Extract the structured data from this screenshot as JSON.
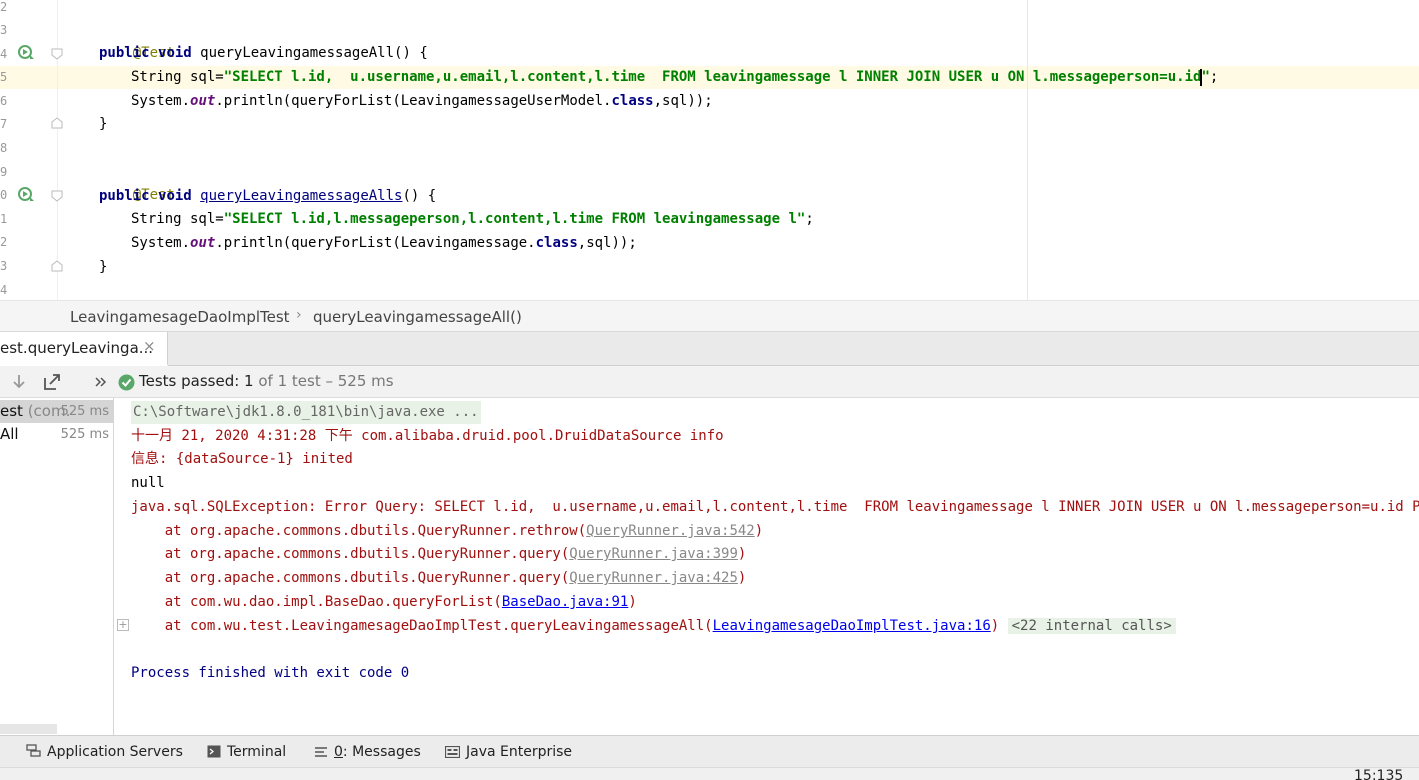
{
  "editor": {
    "line_numbers": [
      "2",
      "3",
      "4",
      "5",
      "6",
      "7",
      "8",
      "9",
      "0",
      "1",
      "2",
      "3",
      "4"
    ],
    "annotation": "@Test",
    "method1_sig": [
      "public",
      "void",
      "queryLeavingamessageAll",
      "() {"
    ],
    "method1_sql_prefix": "String sql=",
    "method1_sql": "\"SELECT l.id,  u.username,u.email,l.content,l.time  FROM leavingamessage l INNER JOIN USER u ON l.messageperson=u.id",
    "method1_sql_end": "\"",
    "line_end": ";",
    "method1_print": [
      "System.",
      "out",
      ".println(queryForList(LeavingamessageUserModel.",
      "class",
      ",sql));"
    ],
    "close_brace": "}",
    "method2_sig": [
      "public",
      "void",
      "queryLeavingamessageAlls",
      "() {"
    ],
    "method2_sql": "\"SELECT l.id,l.messageperson,l.content,l.time FROM leavingamessage l\"",
    "method2_print": [
      "System.",
      "out",
      ".println(queryForList(Leavingamessage.",
      "class",
      ",sql));"
    ]
  },
  "breadcrumb": {
    "class_name": "LeavingamesageDaoImplTest",
    "separator": "›",
    "method_name": "queryLeavingamessageAll()"
  },
  "run_panel": {
    "tab_label": "est.queryLeavinga...",
    "tab_close": "×",
    "tests_passed_label": "Tests passed: ",
    "tests_passed_count": "1",
    "tests_passed_rest": " of 1 test – 525 ms",
    "tree": [
      {
        "name": "est",
        "pkg": " (com.",
        "time": "525 ms"
      },
      {
        "name": "All",
        "pkg": "",
        "time": "525 ms"
      }
    ],
    "console": {
      "cmd": "C:\\Software\\jdk1.8.0_181\\bin\\java.exe ...",
      "log1": "十一月 21, 2020 4:31:28 下午 com.alibaba.druid.pool.DruidDataSource info",
      "log2": "信息: {dataSource-1} inited",
      "null_line": "null",
      "exception": "java.sql.SQLException: Error Query: SELECT l.id,  u.username,u.email,l.content,l.time  FROM leavingamessage l INNER JOIN USER u ON l.messageperson=u.id Parameters: []",
      "stack": [
        {
          "prefix": "    at org.apache.commons.dbutils.QueryRunner.rethrow(",
          "link": "QueryRunner.java:542",
          "suffix": ")"
        },
        {
          "prefix": "    at org.apache.commons.dbutils.QueryRunner.query(",
          "link": "QueryRunner.java:399",
          "suffix": ")"
        },
        {
          "prefix": "    at org.apache.commons.dbutils.QueryRunner.query(",
          "link": "QueryRunner.java:425",
          "suffix": ")"
        },
        {
          "prefix": "    at com.wu.dao.impl.BaseDao.queryForList(",
          "link": "BaseDao.java:91",
          "suffix": ")"
        },
        {
          "prefix": "    at com.wu.test.LeavingamesageDaoImplTest.queryLeavingamessageAll(",
          "link": "LeavingamesageDaoImplTest.java:16",
          "suffix": ")"
        }
      ],
      "internal_calls": "<22 internal calls>",
      "expand_glyph": "+",
      "finished": "Process finished with exit code 0"
    }
  },
  "bottom_bar": {
    "app_servers": "Application Servers",
    "terminal": "Terminal",
    "messages_num": "0",
    "messages_label": ": Messages",
    "java_enterprise": "Java Enterprise"
  },
  "status": {
    "cursor_position": "15:135"
  },
  "colors": {
    "current_line": "#fffae3",
    "keyword": "#000080",
    "string": "#008000",
    "annotation": "#808000",
    "error_text": "#a01010",
    "pass_green": "#59a869"
  }
}
